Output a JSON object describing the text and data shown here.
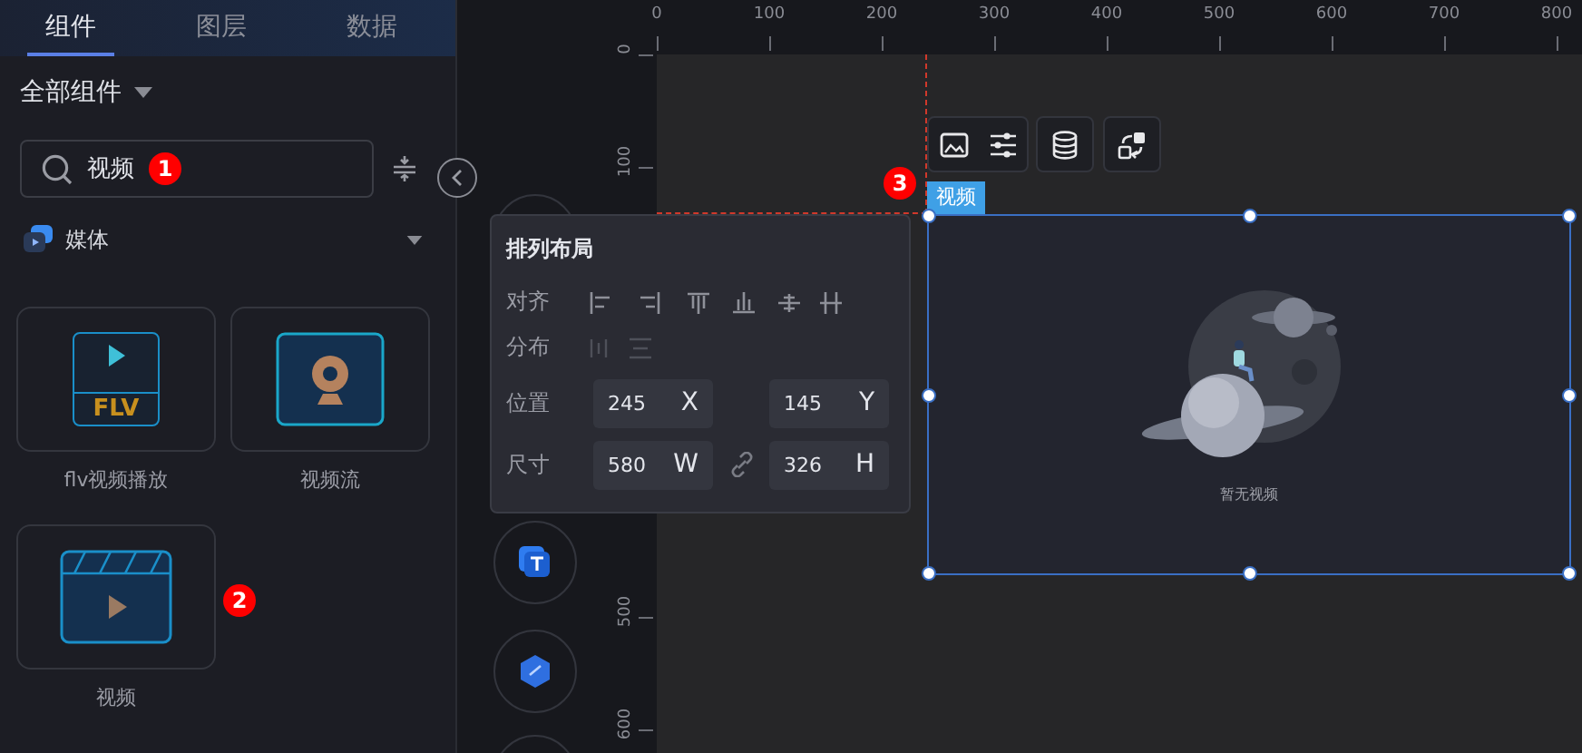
{
  "tabs": [
    {
      "label": "组件",
      "selected": true
    },
    {
      "label": "图层",
      "selected": false
    },
    {
      "label": "数据",
      "selected": false
    }
  ],
  "category_filter": {
    "label": "全部组件"
  },
  "search": {
    "value": "视频",
    "badge": "1"
  },
  "group": {
    "label": "媒体",
    "expanded": true
  },
  "components": [
    {
      "label": "flv视频播放",
      "kind": "flv",
      "icon_text": "FLV"
    },
    {
      "label": "视频流",
      "kind": "camera"
    },
    {
      "label": "视频",
      "kind": "clapper",
      "badge": "2"
    }
  ],
  "ruler": {
    "x_labels": [
      "0",
      "100",
      "200",
      "300",
      "400",
      "500",
      "600",
      "700",
      "800"
    ],
    "y_labels": [
      "0",
      "100",
      "500",
      "600"
    ]
  },
  "layout_panel": {
    "title": "排列布局",
    "align_label": "对齐",
    "distribute_label": "分布",
    "position_label": "位置",
    "size_label": "尺寸",
    "fields": [
      {
        "value": "245",
        "unit": "X"
      },
      {
        "value": "145",
        "unit": "Y"
      },
      {
        "value": "580",
        "unit": "W"
      },
      {
        "value": "326",
        "unit": "H"
      }
    ]
  },
  "selected_widget": {
    "tag": "视频",
    "badge": "3",
    "empty_text": "暂无视频"
  }
}
